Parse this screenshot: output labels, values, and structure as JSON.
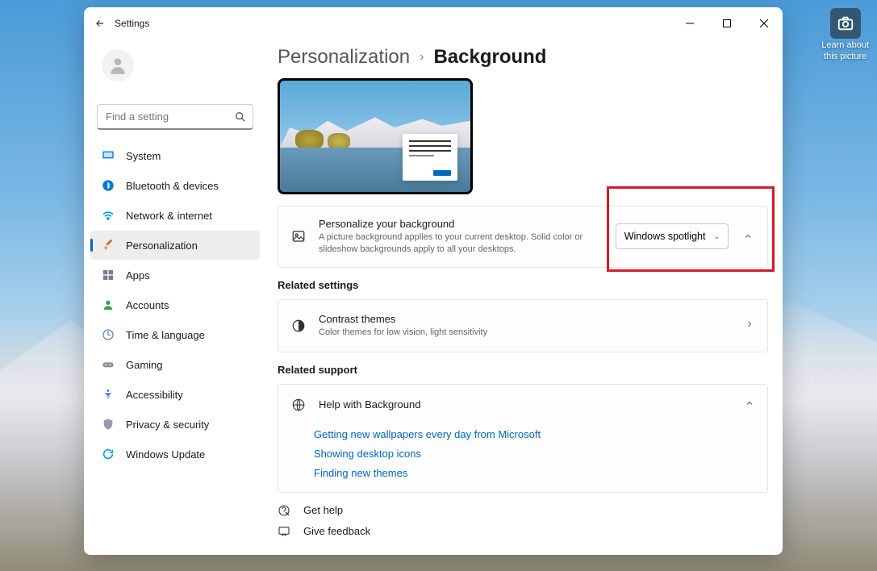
{
  "window": {
    "title": "Settings",
    "titlebar": {
      "minimize": "−",
      "maximize": "▢",
      "close": "✕"
    }
  },
  "search": {
    "placeholder": "Find a setting"
  },
  "sidebar": {
    "items": [
      {
        "key": "system",
        "label": "System"
      },
      {
        "key": "bluetooth",
        "label": "Bluetooth & devices"
      },
      {
        "key": "network",
        "label": "Network & internet"
      },
      {
        "key": "personalization",
        "label": "Personalization",
        "active": true
      },
      {
        "key": "apps",
        "label": "Apps"
      },
      {
        "key": "accounts",
        "label": "Accounts"
      },
      {
        "key": "time",
        "label": "Time & language"
      },
      {
        "key": "gaming",
        "label": "Gaming"
      },
      {
        "key": "accessibility",
        "label": "Accessibility"
      },
      {
        "key": "privacy",
        "label": "Privacy & security"
      },
      {
        "key": "update",
        "label": "Windows Update"
      }
    ]
  },
  "breadcrumb": {
    "parent": "Personalization",
    "sep": "›",
    "current": "Background"
  },
  "personalize": {
    "title": "Personalize your background",
    "desc": "A picture background applies to your current desktop. Solid color or slideshow backgrounds apply to all your desktops.",
    "combo_value": "Windows spotlight"
  },
  "related_settings_label": "Related settings",
  "contrast": {
    "title": "Contrast themes",
    "desc": "Color themes for low vision, light sensitivity"
  },
  "related_support_label": "Related support",
  "help_section": {
    "title": "Help with Background",
    "links": [
      "Getting new wallpapers every day from Microsoft",
      "Showing desktop icons",
      "Finding new themes"
    ]
  },
  "footer": {
    "get_help": "Get help",
    "feedback": "Give feedback"
  },
  "spotlight": {
    "line1": "Learn about",
    "line2": "this picture"
  }
}
